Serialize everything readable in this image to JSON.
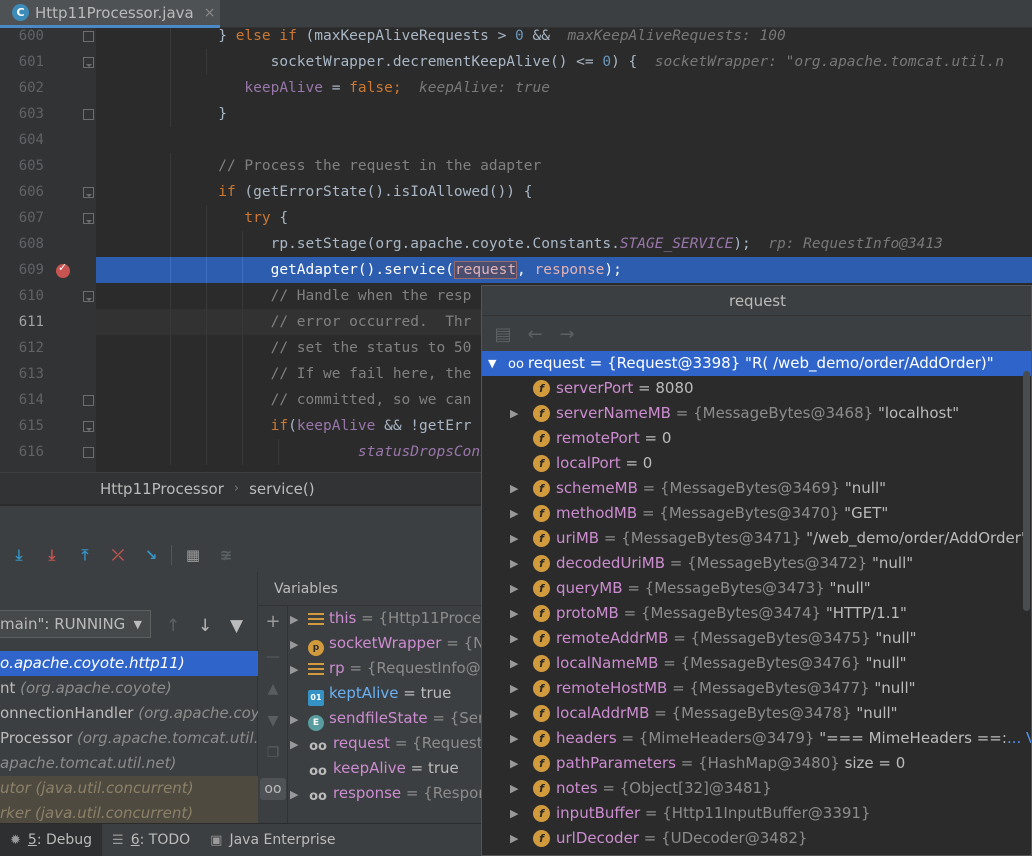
{
  "tab": {
    "filename": "Http11Processor.java",
    "close": "×",
    "icon_letter": "C"
  },
  "editor": {
    "line_numbers": [
      "600",
      "601",
      "602",
      "603",
      "604",
      "605",
      "606",
      "607",
      "608",
      "609",
      "610",
      "611",
      "612",
      "613",
      "614",
      "615",
      "616"
    ],
    "current_line": "611",
    "breakpoint_line": "609"
  },
  "code": {
    "l600": {
      "a": "} ",
      "b": "else if",
      "c": " (maxKeepAliveRequests > ",
      "d": "0",
      "e": " &&",
      "f": "  maxKeepAliveRequests: 100"
    },
    "l601": {
      "a": "socketWrapper.decrementKeepAlive() <= ",
      "b": "0",
      "c": ") {",
      "d": "  socketWrapper: \"org.apache.tomcat.util.n"
    },
    "l602": {
      "a": "keepAlive",
      "b": " = ",
      "c": "false",
      "d": ";",
      "e": "  keepAlive: true"
    },
    "l603": "}",
    "l605": "// Process the request in the adapter",
    "l606": {
      "a": "if",
      "b": " (getErrorState().isIoAllowed()) {"
    },
    "l607": {
      "a": "try",
      "b": " {"
    },
    "l608": {
      "a": "rp.setStage(org.apache.coyote.Constants.",
      "b": "STAGE_SERVICE",
      "c": ");",
      "d": "  rp: RequestInfo@3413"
    },
    "l609": {
      "a": "getAdapter().service(",
      "b": "request",
      "c": ", ",
      "d": "response",
      "e": ");"
    },
    "l610": "// Handle when the resp",
    "l611": "// error occurred.  Thr",
    "l612": "// set the status to 50",
    "l613": "// If we fail here, the",
    "l614": "// committed, so we can",
    "l615": {
      "a": "if",
      "b": "(",
      "c": "keepAlive",
      "d": " && !getErr"
    },
    "l616": "statusDropsConn"
  },
  "breadcrumb": {
    "class": "Http11Processor",
    "method": "service()"
  },
  "debug": {
    "thread": "main\": RUNNING",
    "frames": [
      {
        "name": "",
        "pkg": "o.apache.coyote.http11)"
      },
      {
        "name": "nt ",
        "pkg": "(org.apache.coyote)"
      },
      {
        "name": "onnectionHandler ",
        "pkg": "(org.apache.coyo"
      },
      {
        "name": "Processor ",
        "pkg": "(org.apache.tomcat.util.n"
      },
      {
        "name": "",
        "pkg": "apache.tomcat.util.net)"
      },
      {
        "name": "utor ",
        "pkg": "(java.util.concurrent)"
      },
      {
        "name": "rker ",
        "pkg": "(java.util.concurrent)"
      }
    ],
    "variables_header": "Variables",
    "variables": [
      {
        "name": "this",
        "value": "= {Http11Proce"
      },
      {
        "name": "socketWrapper",
        "value": "= {N"
      },
      {
        "name": "rp",
        "value": "= {RequestInfo@"
      },
      {
        "name": "keptAlive",
        "value": "= true"
      },
      {
        "name": "sendfileState",
        "value": "= {Ser"
      },
      {
        "name": "request",
        "value": "= {Requeste"
      },
      {
        "name": "keepAlive",
        "value": "= true"
      },
      {
        "name": "response",
        "value": "= {Respon"
      }
    ]
  },
  "bottombar": {
    "debug": {
      "num": "5",
      "label": ": Debug"
    },
    "todo": {
      "num": "6",
      "label": ": TODO"
    },
    "java_ee": "Java Enterprise"
  },
  "popup": {
    "title": "request",
    "root": {
      "name": "request",
      "type": "= {Request@3398}",
      "value": "\"R( /web_demo/order/AddOrder)\""
    },
    "fields": [
      {
        "name": "serverPort",
        "type": "",
        "value": "= 8080",
        "expandable": false
      },
      {
        "name": "serverNameMB",
        "type": "= {MessageBytes@3468}",
        "value": "\"localhost\"",
        "expandable": true
      },
      {
        "name": "remotePort",
        "type": "",
        "value": "= 0",
        "expandable": false
      },
      {
        "name": "localPort",
        "type": "",
        "value": "= 0",
        "expandable": false
      },
      {
        "name": "schemeMB",
        "type": "= {MessageBytes@3469}",
        "value": "\"null\"",
        "expandable": true
      },
      {
        "name": "methodMB",
        "type": "= {MessageBytes@3470}",
        "value": "\"GET\"",
        "expandable": true
      },
      {
        "name": "uriMB",
        "type": "= {MessageBytes@3471}",
        "value": "\"/web_demo/order/AddOrder\"",
        "expandable": true
      },
      {
        "name": "decodedUriMB",
        "type": "= {MessageBytes@3472}",
        "value": "\"null\"",
        "expandable": true
      },
      {
        "name": "queryMB",
        "type": "= {MessageBytes@3473}",
        "value": "\"null\"",
        "expandable": true
      },
      {
        "name": "protoMB",
        "type": "= {MessageBytes@3474}",
        "value": "\"HTTP/1.1\"",
        "expandable": true
      },
      {
        "name": "remoteAddrMB",
        "type": "= {MessageBytes@3475}",
        "value": "\"null\"",
        "expandable": true
      },
      {
        "name": "localNameMB",
        "type": "= {MessageBytes@3476}",
        "value": "\"null\"",
        "expandable": true
      },
      {
        "name": "remoteHostMB",
        "type": "= {MessageBytes@3477}",
        "value": "\"null\"",
        "expandable": true
      },
      {
        "name": "localAddrMB",
        "type": "= {MessageBytes@3478}",
        "value": "\"null\"",
        "expandable": true
      },
      {
        "name": "headers",
        "type": "= {MimeHeaders@3479}",
        "value": "\"=== MimeHeaders ==:",
        "link": "... View",
        "expandable": true
      },
      {
        "name": "pathParameters",
        "type": "= {HashMap@3480}",
        "value": " size = 0",
        "expandable": true
      },
      {
        "name": "notes",
        "type": "= {Object[32]@3481}",
        "value": "",
        "expandable": true
      },
      {
        "name": "inputBuffer",
        "type": "= {Http11InputBuffer@3391}",
        "value": "",
        "expandable": true
      },
      {
        "name": "urlDecoder",
        "type": "= {UDecoder@3482}",
        "value": "",
        "expandable": true
      }
    ]
  },
  "icons": {
    "field": "f",
    "protected": "p",
    "enum": "E",
    "boolean": "01"
  },
  "colors": {
    "selection": "#2f65ca",
    "execution_line": "#2d5daf",
    "keyword": "#cc7832",
    "field_name": "#cc8cd0",
    "field_icon": "#d19a3c",
    "breakpoint": "#c75450"
  }
}
